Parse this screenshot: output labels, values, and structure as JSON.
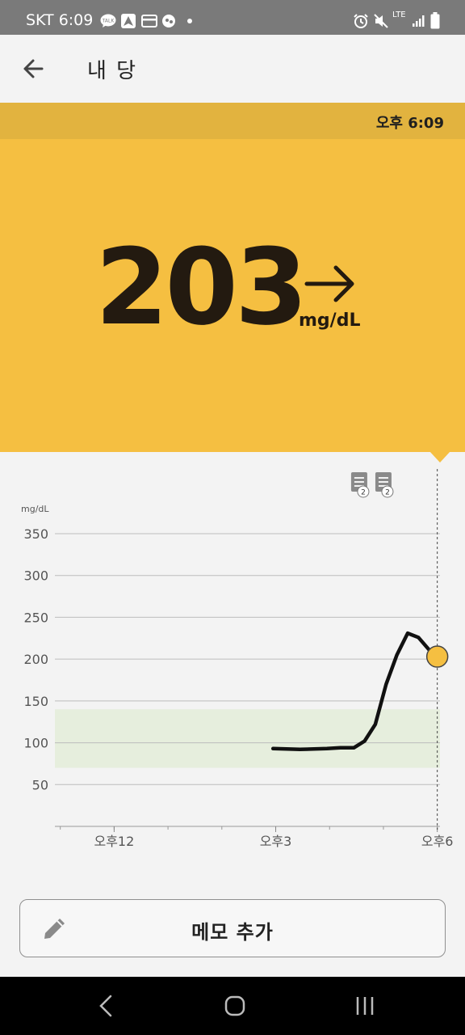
{
  "status_bar": {
    "carrier_time": "SKT 6:09",
    "left_icons": [
      "kakaotalk-icon",
      "navigation-icon",
      "card-icon",
      "app-icon",
      "dot-icon"
    ],
    "right_icons": [
      "alarm-icon",
      "mute-icon",
      "lte-icon",
      "signal-icon",
      "battery-icon"
    ],
    "network": "LTE"
  },
  "app_bar": {
    "title": "내 당",
    "back_icon": "arrow-left-icon"
  },
  "reading": {
    "time": "오후 6:09",
    "value": "203",
    "unit": "mg/dL",
    "trend_icon": "arrow-right-icon",
    "background_color": "#f5bf41",
    "strip_color": "#e2b33f"
  },
  "chart_data": {
    "type": "line",
    "y_unit_label": "mg/dL",
    "yticks": [
      50,
      100,
      150,
      200,
      250,
      300,
      350
    ],
    "ylim": [
      0,
      350
    ],
    "xticks": [
      {
        "label": "오후12",
        "hour": 12
      },
      {
        "label": "오후3",
        "hour": 15
      },
      {
        "label": "오후6",
        "hour": 18
      }
    ],
    "xlim": [
      10.9,
      18.05
    ],
    "target_range": [
      70,
      140
    ],
    "target_color": "#e6eedd",
    "line_color": "#111111",
    "current_marker_color": "#f5bf41",
    "grid": true,
    "series": [
      {
        "points": [
          [
            14.95,
            93
          ],
          [
            15.45,
            92
          ],
          [
            15.95,
            93
          ],
          [
            16.2,
            94
          ],
          [
            16.45,
            94
          ],
          [
            16.65,
            102
          ],
          [
            16.85,
            122
          ],
          [
            17.05,
            170
          ],
          [
            17.25,
            205
          ],
          [
            17.45,
            231
          ],
          [
            17.65,
            226
          ],
          [
            17.85,
            211
          ],
          [
            18.0,
            203
          ]
        ]
      }
    ],
    "current_point": {
      "hour": 18.0,
      "value": 203
    },
    "notes": [
      {
        "icon": "note-icon",
        "count": "2",
        "hour": 16.55
      },
      {
        "icon": "note-icon",
        "count": "2",
        "hour": 17.0
      }
    ]
  },
  "memo_button": {
    "label": "메모 추가",
    "icon": "pencil-icon"
  },
  "nav_bar": {
    "icons": [
      "back-nav-icon",
      "home-nav-icon",
      "recents-nav-icon"
    ]
  }
}
